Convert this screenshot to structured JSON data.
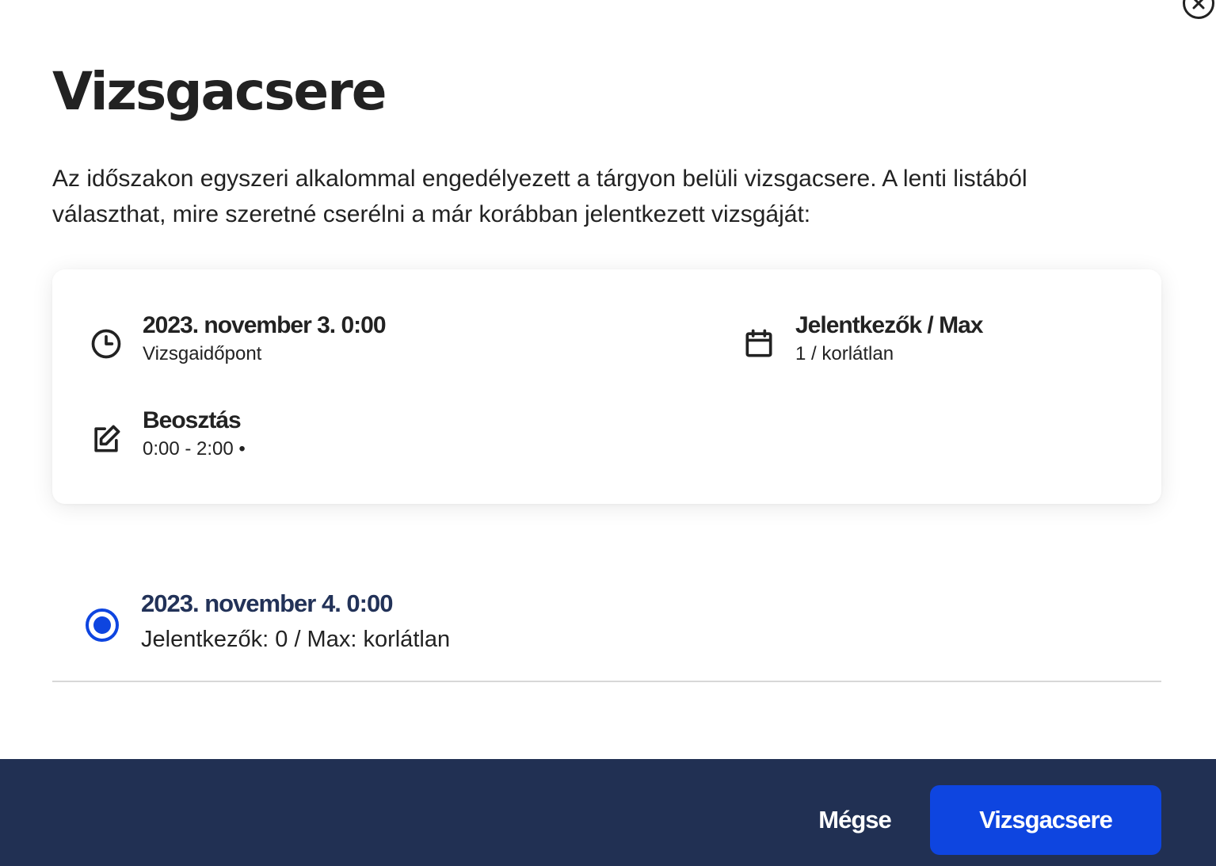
{
  "dialog": {
    "title": "Vizsgacsere",
    "intro": "Az időszakon egyszeri alkalommal engedélyezett a tárgyon belüli vizsgacsere. A lenti listából választhat, mire szeretné cserélni a már korábban jelentkezett vizsgáját:",
    "close_icon": "close-icon"
  },
  "current_exam": {
    "time": {
      "icon": "clock-icon",
      "value": "2023. november 3. 0:00",
      "label": "Vizsgaidőpont"
    },
    "seats": {
      "icon": "calendar-icon",
      "label": "Jelentkezők / Max",
      "value": "1 / korlátlan"
    },
    "assignment": {
      "icon": "edit-icon",
      "label": "Beosztás",
      "value": "0:00 - 2:00 •"
    }
  },
  "options": [
    {
      "title": "2023. november 4. 0:00",
      "subtitle": "Jelentkezők: 0 / Max: korlátlan",
      "selected": true
    }
  ],
  "footer": {
    "cancel_label": "Mégse",
    "confirm_label": "Vizsgacsere"
  },
  "colors": {
    "primary": "#0e45e0",
    "footer_bg": "#213053",
    "option_title": "#223258"
  }
}
